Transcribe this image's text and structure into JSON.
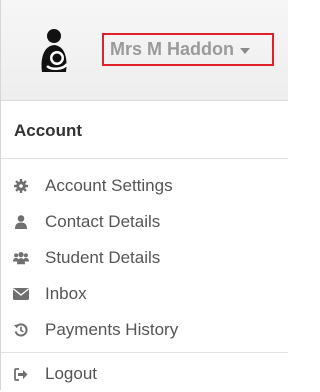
{
  "user": {
    "name": "Mrs M Haddon"
  },
  "section": {
    "title": "Account"
  },
  "menu": {
    "items": [
      {
        "label": "Account Settings",
        "icon": "gear-icon"
      },
      {
        "label": "Contact Details",
        "icon": "user-icon"
      },
      {
        "label": "Student Details",
        "icon": "users-icon"
      },
      {
        "label": "Inbox",
        "icon": "envelope-icon"
      },
      {
        "label": "Payments History",
        "icon": "history-icon"
      },
      {
        "label": "Logout",
        "icon": "sign-out-icon"
      }
    ]
  },
  "colors": {
    "highlight_border": "#e0202a",
    "header_bg": "#f1f1f1",
    "text": "#555555",
    "icon": "#6f6f6f"
  }
}
